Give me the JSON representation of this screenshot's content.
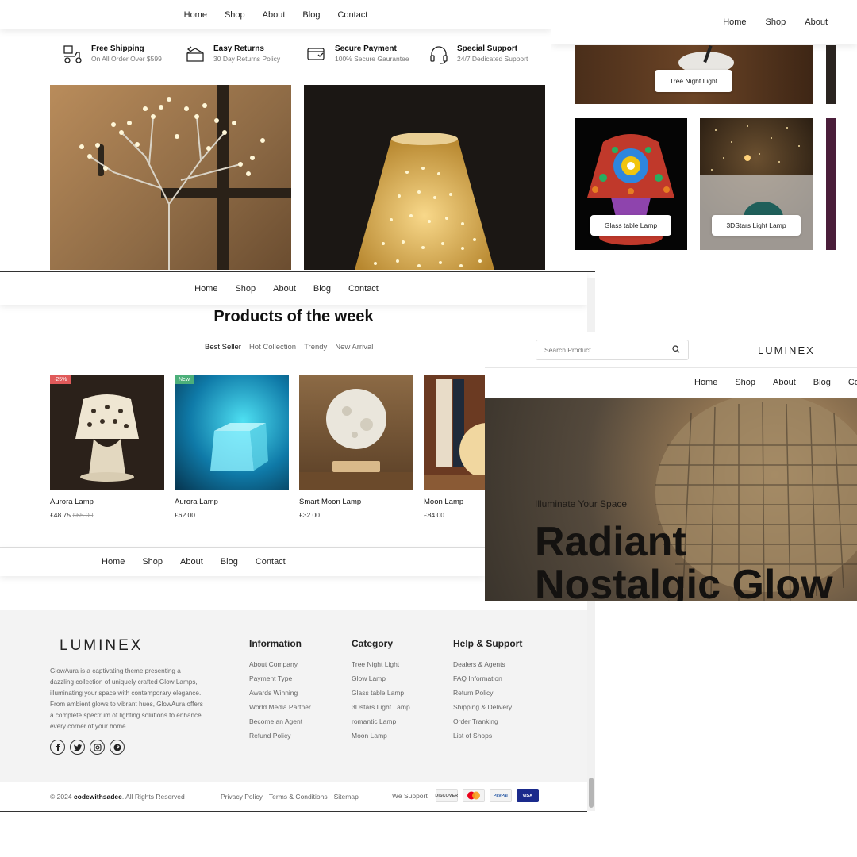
{
  "nav": [
    "Home",
    "Shop",
    "About",
    "Blog",
    "Contact"
  ],
  "nav_top_right": [
    "Home",
    "Shop",
    "About"
  ],
  "nav_right": [
    "Home",
    "Shop",
    "About",
    "Blog",
    "Cont"
  ],
  "features": [
    {
      "title": "Free Shipping",
      "sub": "On All Order Over $599",
      "icon": "delivery-scooter-icon"
    },
    {
      "title": "Easy Returns",
      "sub": "30 Day Returns Policy",
      "icon": "return-box-icon"
    },
    {
      "title": "Secure Payment",
      "sub": "100% Secure Gaurantee",
      "icon": "secure-card-icon"
    },
    {
      "title": "Special Support",
      "sub": "24/7 Dedicated Support",
      "icon": "headset-icon"
    }
  ],
  "categories": {
    "tree": "Tree Night Light",
    "glass": "Glass table Lamp",
    "stars": "3DStars Light Lamp"
  },
  "products_section": {
    "title": "Products of the week",
    "tabs": [
      "Best Seller",
      "Hot Collection",
      "Trendy",
      "New Arrival"
    ],
    "items": [
      {
        "name": "Aurora Lamp",
        "price": "£48.75",
        "old_price": "£65.00",
        "badge": "-25%"
      },
      {
        "name": "Aurora Lamp",
        "price": "£62.00",
        "old_price": "",
        "badge": "New"
      },
      {
        "name": "Smart Moon Lamp",
        "price": "£32.00",
        "old_price": "",
        "badge": ""
      },
      {
        "name": "Moon Lamp",
        "price": "£84.00",
        "old_price": "",
        "badge": ""
      }
    ]
  },
  "footer": {
    "logo": "LUMINEX",
    "about": "GlowAura is a captivating theme presenting a dazzling collection of uniquely crafted Glow Lamps, illuminating your space with contemporary elegance. From ambient glows to vibrant hues, GlowAura offers a complete spectrum of lighting solutions to enhance every corner of your home",
    "info_title": "Information",
    "info": [
      "About Company",
      "Payment Type",
      "Awards Winning",
      "World Media Partner",
      "Become an Agent",
      "Refund Policy"
    ],
    "cat_title": "Category",
    "cat": [
      "Tree Night Light",
      "Glow Lamp",
      "Glass table Lamp",
      "3Dstars Light Lamp",
      "romantic Lamp",
      "Moon Lamp"
    ],
    "help_title": "Help & Support",
    "help": [
      "Dealers & Agents",
      "FAQ Information",
      "Return Policy",
      "Shipping & Delivery",
      "Order Tranking",
      "List of Shops"
    ],
    "copyright_pre": "© 2024",
    "copyright_brand": "codewithsadee",
    "copyright_post": ". All Rights Reserved",
    "links": [
      "Privacy Policy",
      "Terms & Conditions",
      "Sitemap"
    ],
    "we_support": "We Support",
    "cards": [
      "DISCOVER",
      "",
      "PayPal",
      "VISA"
    ]
  },
  "hero": {
    "search_placeholder": "Search Product...",
    "logo": "LUMINEX",
    "kicker": "Illuminate Your Space",
    "title_line1": "Radiant",
    "title_line2": "Nostalgic Glow"
  }
}
